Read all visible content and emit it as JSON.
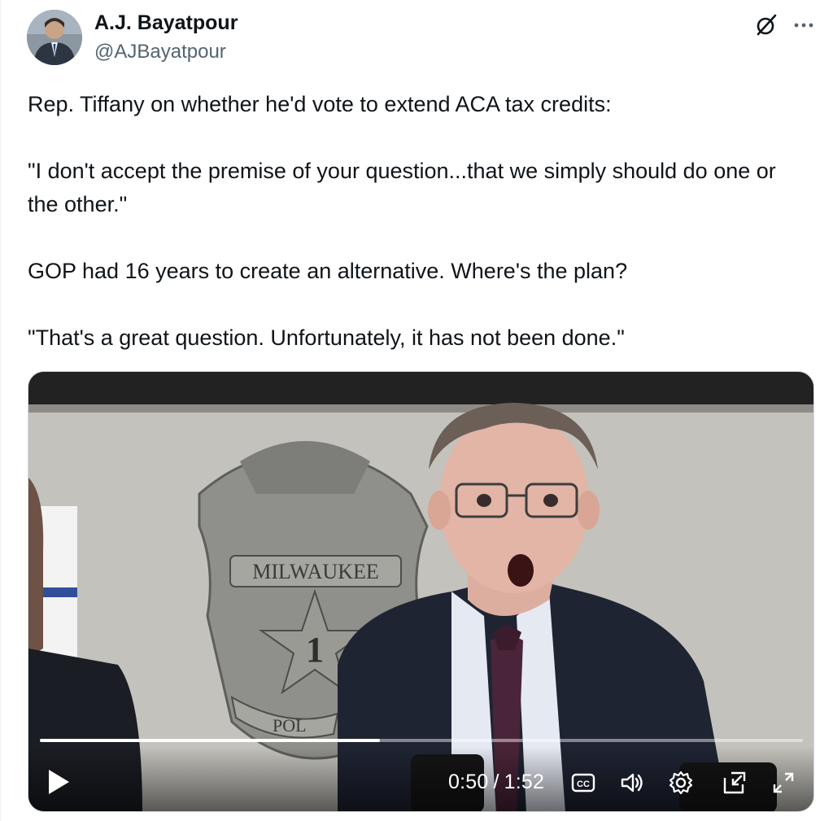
{
  "author": {
    "name": "A.J. Bayatpour",
    "handle": "@AJBayatpour"
  },
  "tweet": {
    "lines": [
      "Rep. Tiffany on whether he'd vote to extend ACA tax credits:",
      "\"I don't accept the premise of your question...that we simply should do one or the other.\"",
      "GOP had 16 years to create an alternative. Where's the plan?",
      "\"That's a great question. Unfortunately, it has not been done.\""
    ]
  },
  "video": {
    "current_time": "0:50",
    "separator": "/",
    "duration": "1:52",
    "progress": 0.446,
    "badge_text": "MILWAUKEE",
    "badge_number": "1",
    "badge_bottom": "POL"
  },
  "icons": {
    "grok": "grok-icon",
    "more": "more-icon",
    "play": "play-icon",
    "captions": "captions-icon",
    "volume": "volume-icon",
    "settings": "gear-icon",
    "pip": "picture-in-picture-icon",
    "fullscreen": "fullscreen-icon"
  }
}
